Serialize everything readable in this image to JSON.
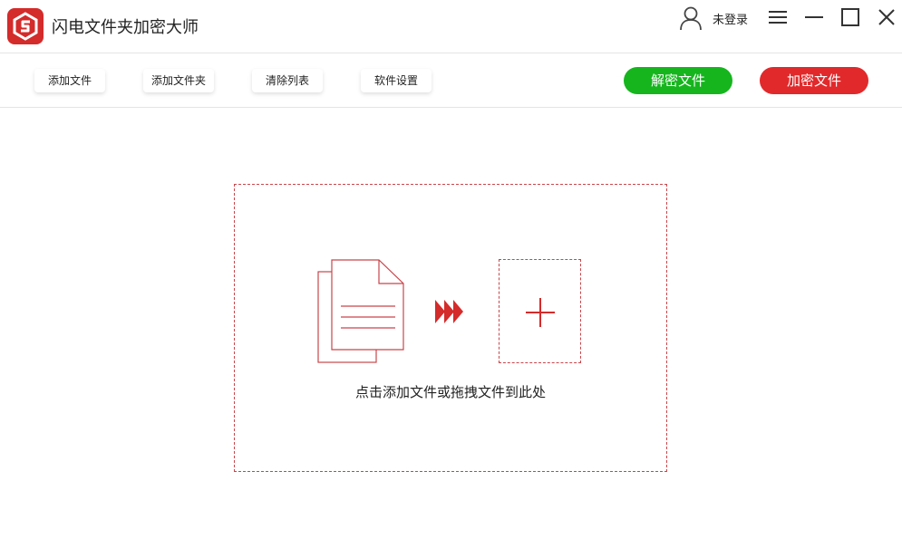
{
  "app": {
    "title": "闪电文件夹加密大师",
    "logo_icon": "app-logo-icon",
    "brand_color": "#d42b2b"
  },
  "titlebar": {
    "login_label": "未登录",
    "icons": [
      "user-icon",
      "menu-icon",
      "minimize-icon",
      "maximize-icon",
      "close-icon"
    ]
  },
  "toolbar": {
    "add_file": "添加文件",
    "add_folder": "添加文件夹",
    "clear_list": "清除列表",
    "settings": "软件设置",
    "decrypt_label": "解密文件",
    "encrypt_label": "加密文件",
    "decrypt_color": "#16b51e",
    "encrypt_color": "#e1292b"
  },
  "dropzone": {
    "hint": "点击添加文件或拖拽文件到此处",
    "icons": [
      "document-icon",
      "forward-arrows-icon",
      "plus-icon"
    ],
    "accent_color": "#c9454a"
  }
}
